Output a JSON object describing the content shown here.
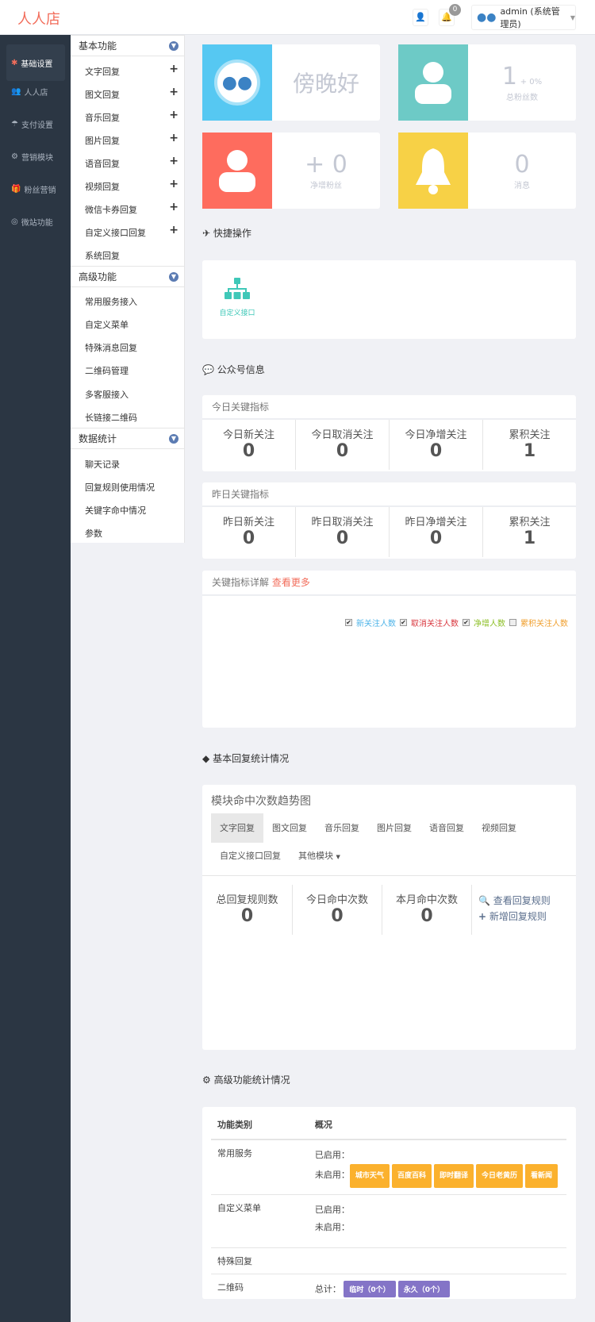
{
  "header": {
    "brand": "人人店",
    "notif_count": "0",
    "user": "admin (系统管理员)"
  },
  "sidebar": [
    "基础设置",
    "人人店",
    "支付设置",
    "营销模块",
    "粉丝营销",
    "微站功能"
  ],
  "submenu": {
    "g1": {
      "title": "基本功能",
      "items": [
        "文字回复",
        "图文回复",
        "音乐回复",
        "图片回复",
        "语音回复",
        "视频回复",
        "微信卡券回复",
        "自定义接口回复",
        "系统回复"
      ]
    },
    "g2": {
      "title": "高级功能",
      "items": [
        "常用服务接入",
        "自定义菜单",
        "特殊消息回复",
        "二维码管理",
        "多客服接入",
        "长链接二维码"
      ]
    },
    "g3": {
      "title": "数据统计",
      "items": [
        "聊天记录",
        "回复规则使用情况",
        "关键字命中情况",
        "参数"
      ]
    }
  },
  "stats": {
    "greeting": "傍晚好",
    "fans": "1",
    "fans_pct": "+ 0%",
    "fans_label": "总粉丝数",
    "net": "+ 0",
    "net_label": "净增粉丝",
    "msgs": "0",
    "msgs_label": "消息",
    "colors": {
      "blue": "#56c8f2",
      "teal": "#6dcac6",
      "red": "#fe6c5e",
      "yellow": "#f7d146"
    }
  },
  "quick": {
    "title": "快捷操作",
    "items": [
      "自定义接口"
    ]
  },
  "account": {
    "title": "公众号信息"
  },
  "today": {
    "title": "今日关键指标",
    "items": [
      {
        "t": "今日新关注",
        "n": "0"
      },
      {
        "t": "今日取消关注",
        "n": "0"
      },
      {
        "t": "今日净增关注",
        "n": "0"
      },
      {
        "t": "累积关注",
        "n": "1"
      }
    ]
  },
  "yesterday": {
    "title": "昨日关键指标",
    "items": [
      {
        "t": "昨日新关注",
        "n": "0"
      },
      {
        "t": "昨日取消关注",
        "n": "0"
      },
      {
        "t": "昨日净增关注",
        "n": "0"
      },
      {
        "t": "累积关注",
        "n": "1"
      }
    ]
  },
  "detail": {
    "title": "关键指标详解",
    "more": "查看更多",
    "legend": [
      "新关注人数",
      "取消关注人数",
      "净增人数",
      "累积关注人数"
    ]
  },
  "basic": {
    "title": "基本回复统计情况",
    "card_title": "模块命中次数趋势图",
    "tabs": [
      "文字回复",
      "图文回复",
      "音乐回复",
      "图片回复",
      "语音回复",
      "视频回复",
      "自定义接口回复",
      "其他模块"
    ],
    "kpis": [
      {
        "t": "总回复规则数",
        "n": "0"
      },
      {
        "t": "今日命中次数",
        "n": "0"
      },
      {
        "t": "本月命中次数",
        "n": "0"
      }
    ],
    "view_rules": "查看回复规则",
    "add_rule": "新增回复规则"
  },
  "advanced": {
    "title": "高级功能统计情况",
    "col1": "功能类别",
    "col2": "概况",
    "enabled": "已启用：",
    "disabled": "未启用：",
    "total": "总计：",
    "rows": [
      "常用服务",
      "自定义菜单",
      "特殊回复",
      "二维码"
    ],
    "services": [
      "城市天气",
      "百度百科",
      "即时翻译",
      "今日老黄历",
      "看新闻"
    ],
    "qr": [
      "临时（0个）",
      "永久（0个）"
    ]
  }
}
